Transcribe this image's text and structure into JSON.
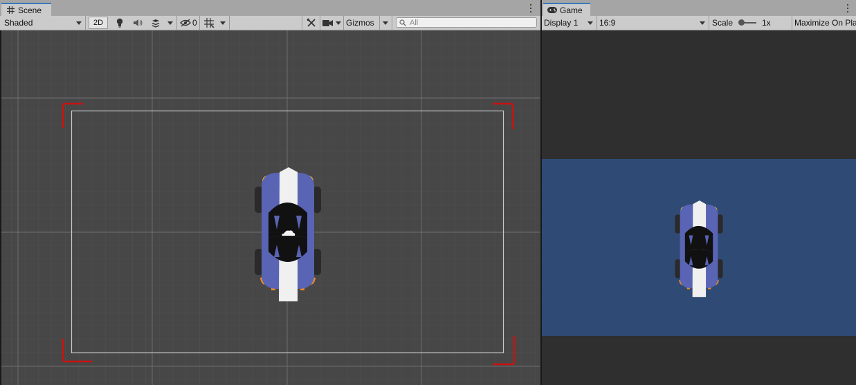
{
  "scene": {
    "tab_label": "Scene",
    "shading_mode": "Shaded",
    "mode_2d_label": "2D",
    "hidden_count": "0",
    "gizmos_label": "Gizmos",
    "search_placeholder": "All"
  },
  "game": {
    "tab_label": "Game",
    "display": "Display 1",
    "aspect": "16:9",
    "scale_label": "Scale",
    "scale_value": "1x",
    "maximize_label": "Maximize On Play"
  },
  "icons": {
    "scene_tab": "grid-icon",
    "game_tab": "gamepad-icon",
    "lighting": "lightbulb-icon",
    "audio": "speaker-icon",
    "effects": "layers-icon",
    "visibility": "eye-slash-icon",
    "grid": "grid-snap-icon",
    "tools": "tools-icon",
    "camera": "camera-icon",
    "menu": "kebab-menu-icon"
  },
  "colors": {
    "accent": "#3a79bb",
    "camera_bounds": "#cc1111",
    "game_background": "#2f4b75",
    "scene_background": "#474747",
    "car_body": "#5964b4",
    "car_stripe": "#f0f0f0"
  }
}
